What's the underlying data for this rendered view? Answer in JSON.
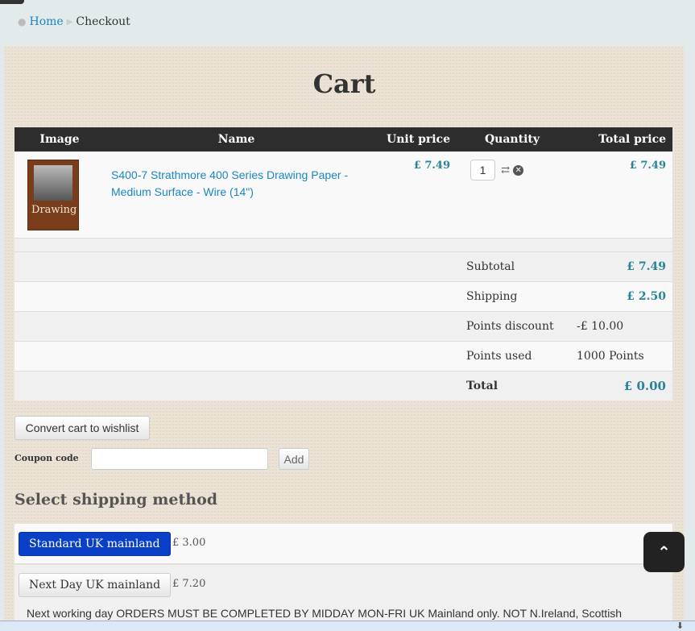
{
  "breadcrumb": {
    "home": "Home",
    "current": "Checkout"
  },
  "title": "Cart",
  "table": {
    "headers": [
      "Image",
      "Name",
      "Unit price",
      "Quantity",
      "Total price"
    ],
    "items": [
      {
        "image_text": "Drawing",
        "name": "S400-7 Strathmore 400 Series Drawing Paper - Medium Surface - Wire (14\")",
        "unit_price": "£ 7.49",
        "quantity": "1",
        "total_price": "£ 7.49"
      }
    ],
    "summary": [
      {
        "label": "Subtotal",
        "value": "£ 7.49"
      },
      {
        "label": "Shipping",
        "value": "£ 2.50"
      },
      {
        "label": "Points discount",
        "value": "-£ 10.00"
      },
      {
        "label": "Points used",
        "value": "1000 Points"
      },
      {
        "label": "Total",
        "value": "£ 0.00"
      }
    ]
  },
  "convert_label": "Convert cart to wishlist",
  "coupon": {
    "label": "Coupon code",
    "value": "",
    "add_label": "Add"
  },
  "shipping": {
    "heading": "Select shipping method",
    "methods": [
      {
        "label": "Standard UK mainland",
        "price": "£ 3.00",
        "selected": true
      },
      {
        "label": "Next Day UK mainland",
        "price": "£ 7.20",
        "selected": false
      }
    ],
    "note": "Next working day ORDERS MUST BE COMPLETED BY MIDDAY MON-FRI UK Mainland only. NOT N.Ireland, Scottish"
  },
  "colors": {
    "accent": "#2a8396",
    "link": "#1a86c2",
    "selected": "#0a3fc8"
  }
}
